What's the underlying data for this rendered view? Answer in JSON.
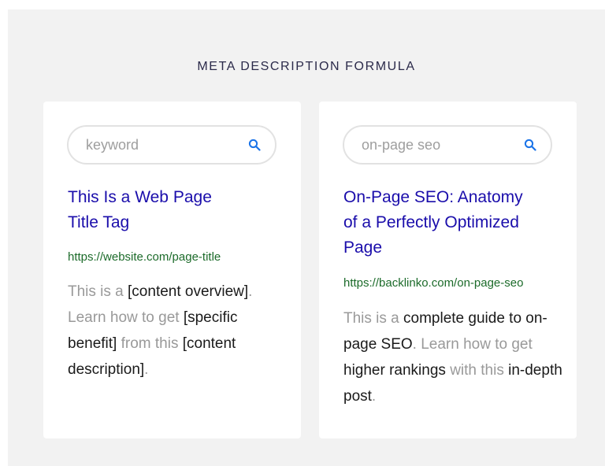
{
  "heading": "META DESCRIPTION FORMULA",
  "cards": [
    {
      "search_text": "keyword",
      "title_lines": [
        "This Is a Web Page",
        "Title Tag"
      ],
      "url": "https://website.com/page-title",
      "desc": {
        "p1": "This is a ",
        "p2": "[content overview]",
        "p3": ". Learn how to get ",
        "p4": "[specific benefit]",
        "p5": " from this ",
        "p6": "[content description]",
        "p7": "."
      }
    },
    {
      "search_text": "on-page seo",
      "title_lines": [
        "On-Page SEO: Anatomy",
        "of a Perfectly Optimized",
        "Page"
      ],
      "url": "https://backlinko.com/on-page-seo",
      "desc": {
        "p1": "This is a ",
        "p2": "complete guide to on-page SEO",
        "p3": ". Learn how to get ",
        "p4": "higher rankings",
        "p5": " with this ",
        "p6": "in-depth post",
        "p7": "."
      }
    }
  ],
  "icons": {
    "search": "search-icon"
  },
  "colors": {
    "title": "#1a0dab",
    "url": "#1c6b2a",
    "emphasis": "#1a1a1a",
    "muted": "#999999",
    "search_icon": "#1a73e8"
  }
}
